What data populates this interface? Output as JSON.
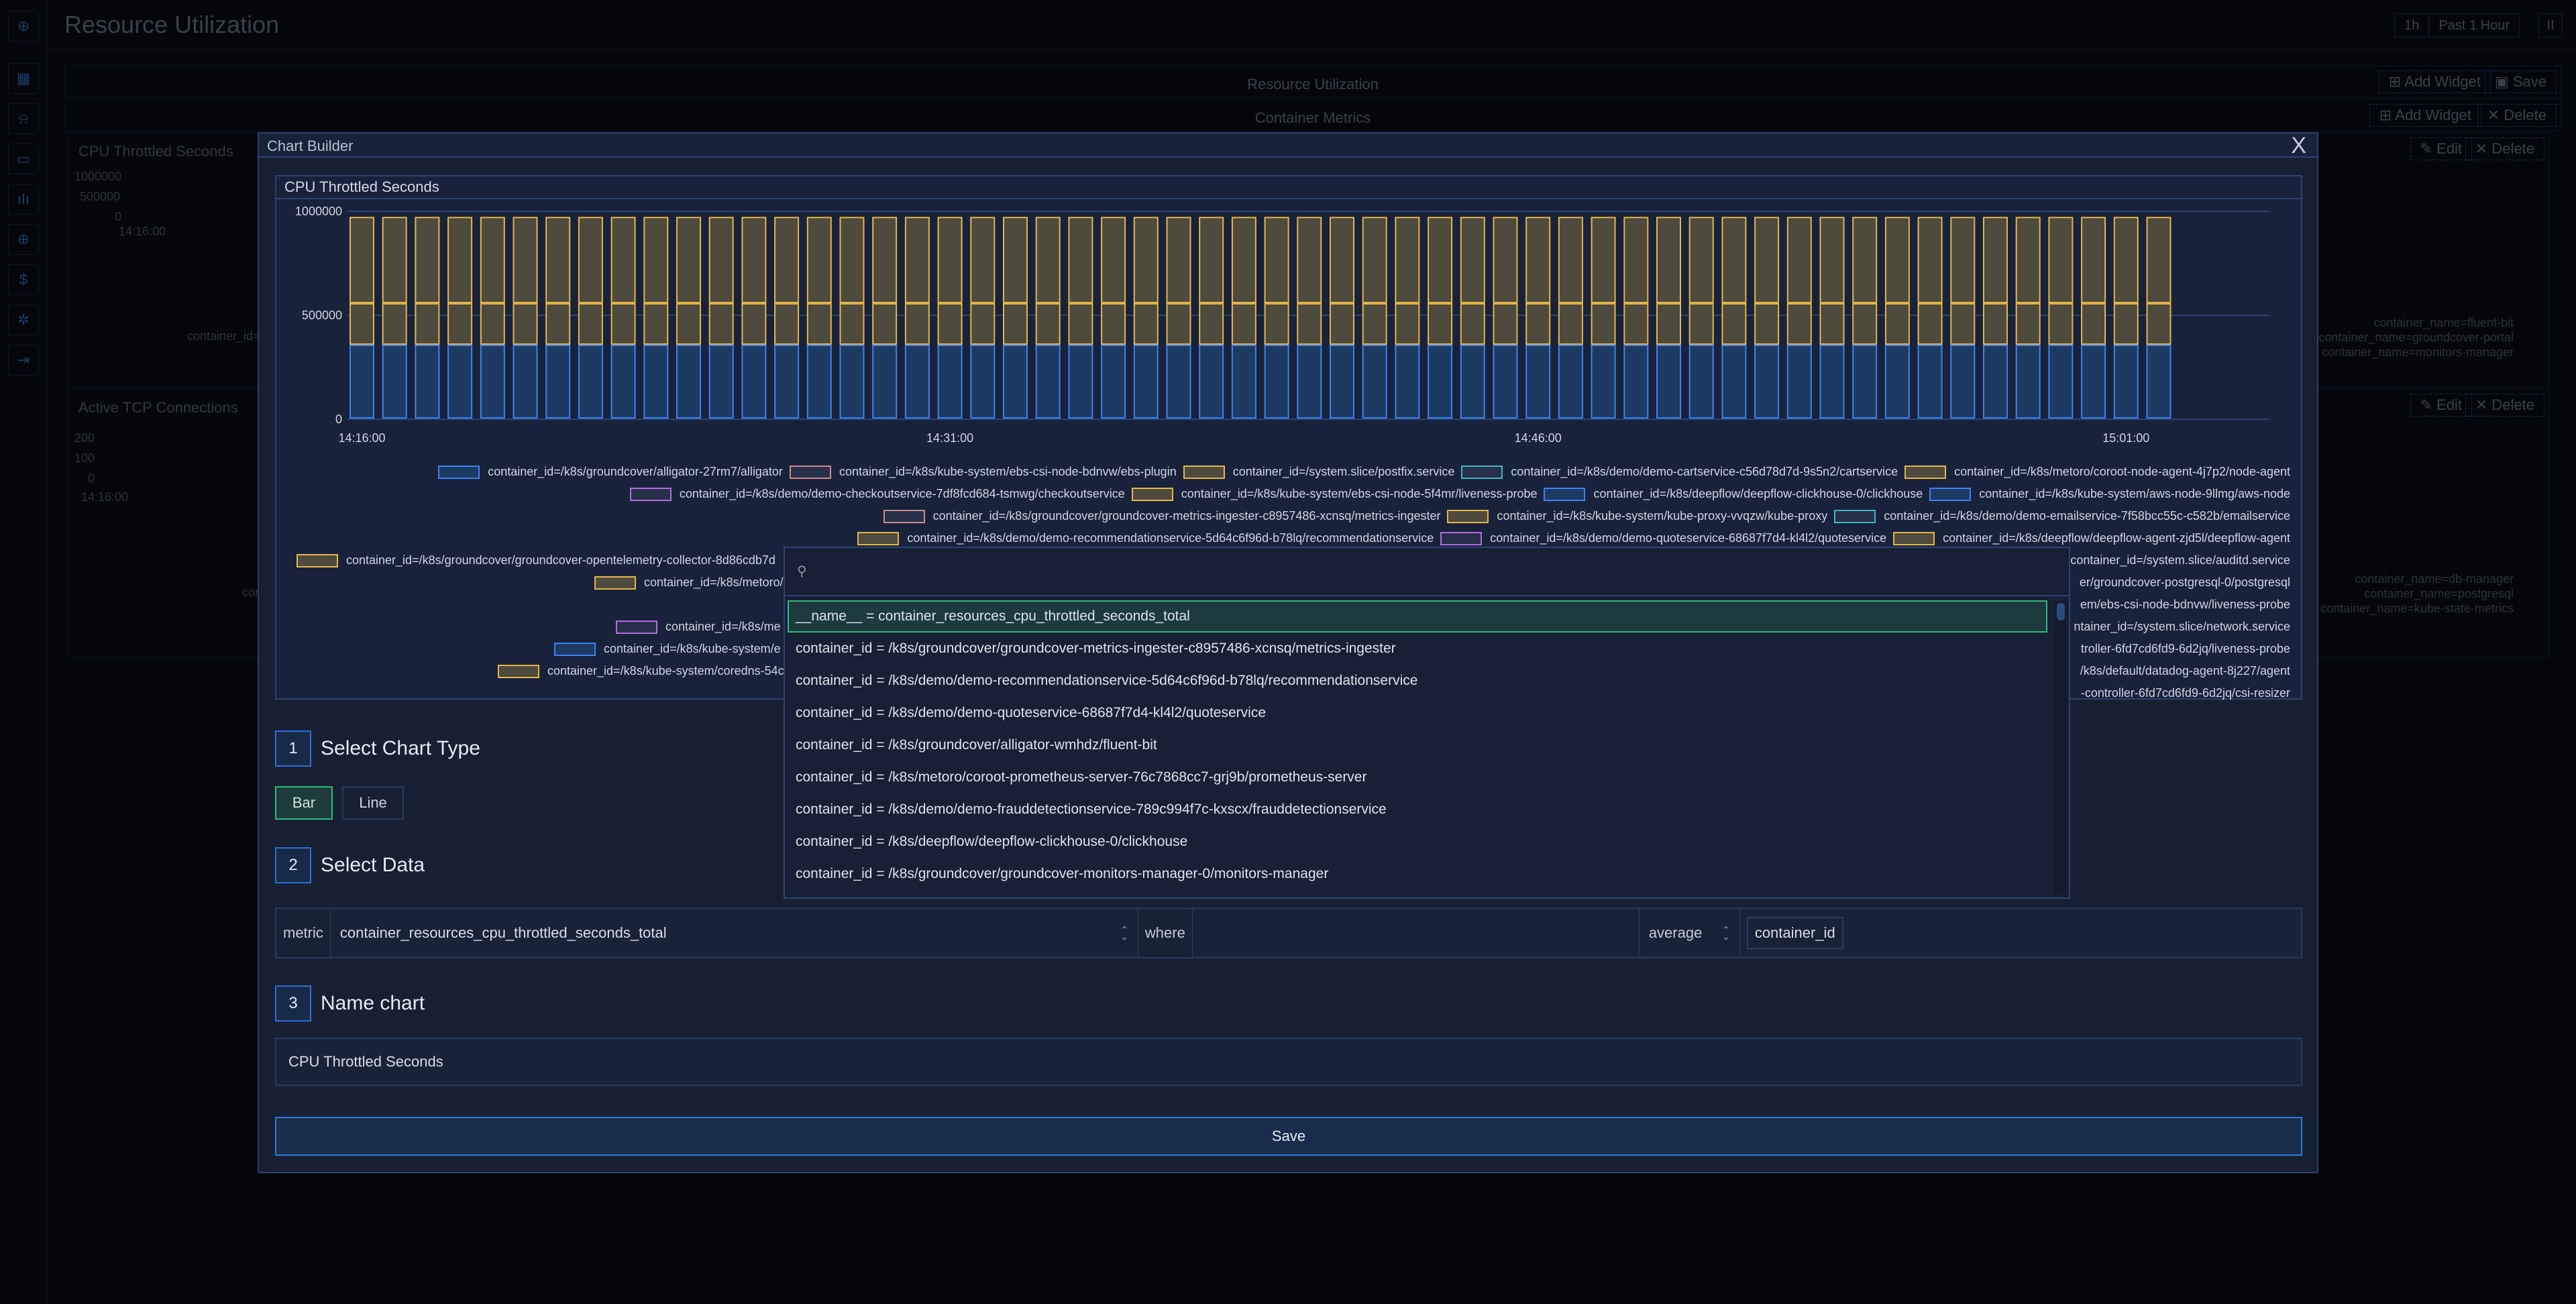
{
  "app": {
    "page_title": "Resource Utilization",
    "time_quick": "1h",
    "time_range": "Past 1 Hour",
    "pause_label": "II"
  },
  "background": {
    "section_title": "Resource Utilization",
    "subsection_title": "Container Metrics",
    "add_widget_label": "Add Widget",
    "save_label": "Save",
    "delete_label": "Delete",
    "edit_label": "Edit",
    "panels": [
      {
        "title": "CPU Throttled Seconds",
        "y_ticks": [
          "1000000",
          "500000",
          "0"
        ],
        "x_tick": "14:16:00",
        "legend_snippet": "container_id="
      },
      {
        "title": "Active TCP Connections",
        "y_ticks": [
          "200",
          "100",
          "0"
        ],
        "x_tick": "14:16:00",
        "legend_snippet": "con"
      }
    ],
    "right_legend_1": [
      "container_name=fluent-bit",
      "container_name=groundcover-portal",
      "container_name=monitors-manager"
    ],
    "right_legend_2": [
      "container_name=db-manager",
      "container_name=postgresql",
      "container_name=kube-state-metrics"
    ]
  },
  "modal": {
    "title": "Chart Builder",
    "close_label": "X",
    "preview_title": "CPU Throttled Seconds",
    "steps": [
      {
        "num": "1",
        "title": "Select Chart Type"
      },
      {
        "num": "2",
        "title": "Select Data"
      },
      {
        "num": "3",
        "title": "Name chart"
      }
    ],
    "chart_types": [
      "Bar",
      "Line"
    ],
    "selected_chart_type": "Bar",
    "query": {
      "metric_label": "metric",
      "metric_value": "container_resources_cpu_throttled_seconds_total",
      "where_label": "where",
      "where_value": "",
      "aggregation": "average",
      "group_by": "container_id"
    },
    "chart_name": "CPU Throttled Seconds",
    "save_label": "Save"
  },
  "dropdown": {
    "search_placeholder": "",
    "items": [
      "__name__ = container_resources_cpu_throttled_seconds_total",
      "container_id = /k8s/groundcover/groundcover-metrics-ingester-c8957486-xcnsq/metrics-ingester",
      "container_id = /k8s/demo/demo-recommendationservice-5d64c6f96d-b78lq/recommendationservice",
      "container_id = /k8s/demo/demo-quoteservice-68687f7d4-kl4l2/quoteservice",
      "container_id = /k8s/groundcover/alligator-wmhdz/fluent-bit",
      "container_id = /k8s/metoro/coroot-prometheus-server-76c7868cc7-grj9b/prometheus-server",
      "container_id = /k8s/demo/demo-frauddetectionservice-789c994f7c-kxscx/frauddetectionservice",
      "container_id = /k8s/deepflow/deepflow-clickhouse-0/clickhouse",
      "container_id = /k8s/groundcover/groundcover-monitors-manager-0/monitors-manager"
    ],
    "active_index": 0
  },
  "legend": {
    "rows": [
      [
        {
          "label": "container_id=/k8s/groundcover/alligator-27rm7/alligator",
          "color": "#3b82f6"
        },
        {
          "label": "container_id=/k8s/kube-system/ebs-csi-node-bdnvw/ebs-plugin",
          "color": "#c98b8b"
        },
        {
          "label": "container_id=/system.slice/postfix.service",
          "color": "#e5b64a"
        },
        {
          "label": "container_id=/k8s/demo/demo-cartservice-c56d78d7d-9s5n2/cartservice",
          "color": "#3fb7c0"
        },
        {
          "label": "container_id=/k8s/metoro/coroot-node-agent-4j7p2/node-agent",
          "color": "#e5b64a"
        }
      ],
      [
        {
          "label": "container_id=/k8s/demo/demo-checkoutservice-7df8fcd684-tsmwg/checkoutservice",
          "color": "#b46be0"
        },
        {
          "label": "container_id=/k8s/kube-system/ebs-csi-node-5f4mr/liveness-probe",
          "color": "#e5b64a"
        },
        {
          "label": "container_id=/k8s/deepflow/deepflow-clickhouse-0/clickhouse",
          "color": "#3b82f6"
        },
        {
          "label": "container_id=/k8s/kube-system/aws-node-9llmg/aws-node",
          "color": "#3b82f6"
        }
      ],
      [
        {
          "label": "container_id=/k8s/groundcover/groundcover-metrics-ingester-c8957486-xcnsq/metrics-ingester",
          "color": "#c98b8b"
        },
        {
          "label": "container_id=/k8s/kube-system/kube-proxy-vvqzw/kube-proxy",
          "color": "#e5b64a"
        },
        {
          "label": "container_id=/k8s/demo/demo-emailservice-7f58bcc55c-c582b/emailservice",
          "color": "#3fb7c0"
        }
      ],
      [
        {
          "label": "container_id=/k8s/demo/demo-recommendationservice-5d64c6f96d-b78lq/recommendationservice",
          "color": "#e5b64a"
        },
        {
          "label": "container_id=/k8s/demo/demo-quoteservice-68687f7d4-kl4l2/quoteservice",
          "color": "#b46be0"
        },
        {
          "label": "container_id=/k8s/deepflow/deepflow-agent-zjd5l/deepflow-agent",
          "color": "#e5b64a"
        }
      ]
    ],
    "partial_left": [
      {
        "label": "container_id=/k8s/groundcover/groundcover-opentelemetry-collector-8d86cdb7d",
        "color": "#e5b64a"
      },
      {
        "label": "container_id=/k8s/metoro/",
        "color": "#e5b64a"
      },
      {
        "label": "container_id=/k8s/me",
        "color": "#b46be0"
      },
      {
        "label": "container_id=/k8s/kube-system/e",
        "color": "#3b82f6"
      },
      {
        "label": "container_id=/k8s/kube-system/coredns-54c",
        "color": "#e5b64a"
      }
    ],
    "partial_right": [
      "container_id=/system.slice/auditd.service",
      "er/groundcover-postgresql-0/postgresql",
      "em/ebs-csi-node-bdnvw/liveness-probe",
      "ntainer_id=/system.slice/network.service",
      "troller-6fd7cd6fd9-6d2jq/liveness-probe",
      "/k8s/default/datadog-agent-8j227/agent",
      "-controller-6fd7cd6fd9-6d2jq/csi-resizer"
    ]
  },
  "chart_data": {
    "type": "bar",
    "stacked": true,
    "title": "CPU Throttled Seconds",
    "xlabel": "",
    "ylabel": "",
    "ylim": [
      0,
      1000000
    ],
    "y_ticks": [
      0,
      500000,
      1000000
    ],
    "x_tick_labels": [
      "14:16:00",
      "14:31:00",
      "14:46:00",
      "15:01:00"
    ],
    "bar_count": 56,
    "grid": true,
    "legend_position": "bottom",
    "series": [
      {
        "name": "container_id=/k8s/groundcover/alligator-27rm7/alligator",
        "color": "#3b82f6",
        "fill": "#1d3a63",
        "value_per_bar": 355000
      },
      {
        "name": "container_id=/system.slice/postfix.service",
        "color": "#e5b64a",
        "fill": "#4e4a3d",
        "value_per_bar": 200000
      },
      {
        "name": "container_id=/k8s/metoro/coroot-node-agent-4j7p2/node-agent",
        "color": "#e5b64a",
        "fill": "#4e4a3d",
        "value_per_bar": 415000
      }
    ]
  }
}
